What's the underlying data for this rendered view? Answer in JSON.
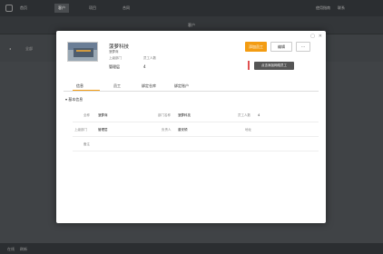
{
  "topbar": {
    "nav": [
      "首页",
      "客户",
      "项目",
      "合同"
    ],
    "right": [
      "使用指南",
      "联系"
    ]
  },
  "titlebar": {
    "title": "客户"
  },
  "toolbar": {
    "items": [
      "全部"
    ]
  },
  "statusbar": {
    "left": "在线",
    "right": "刷新"
  },
  "modal": {
    "window_icons": [
      "square-icon",
      "close-icon"
    ],
    "company": {
      "name": "菠萝科技",
      "subtitle": "菠萝商",
      "parent_label": "上级部门",
      "parent_value": "管理层",
      "staff_label": "员工人数",
      "staff_value": "4"
    },
    "buttons": {
      "primary": "添加员工",
      "edit": "编辑",
      "more": "···"
    },
    "tooltip": "点击添加网络员工",
    "tabs": [
      "信息",
      "员工",
      "绑定仓库",
      "绑定账户"
    ],
    "active_tab": 0,
    "section_title": "基本信息",
    "fields": {
      "row1": [
        {
          "label": "全称",
          "value": "菠萝商"
        },
        {
          "label": "部门名称",
          "value": "菠萝科技"
        },
        {
          "label": "员工人数",
          "value": "4"
        }
      ],
      "row2": [
        {
          "label": "上级部门",
          "value": "管理层"
        },
        {
          "label": "负责人",
          "value": "曾安顿"
        },
        {
          "label": "地址",
          "value": ""
        }
      ],
      "row3": [
        {
          "label": "备注",
          "value": ""
        }
      ]
    }
  },
  "colors": {
    "accent": "#f39c12",
    "tooltip_bg": "#555555"
  }
}
